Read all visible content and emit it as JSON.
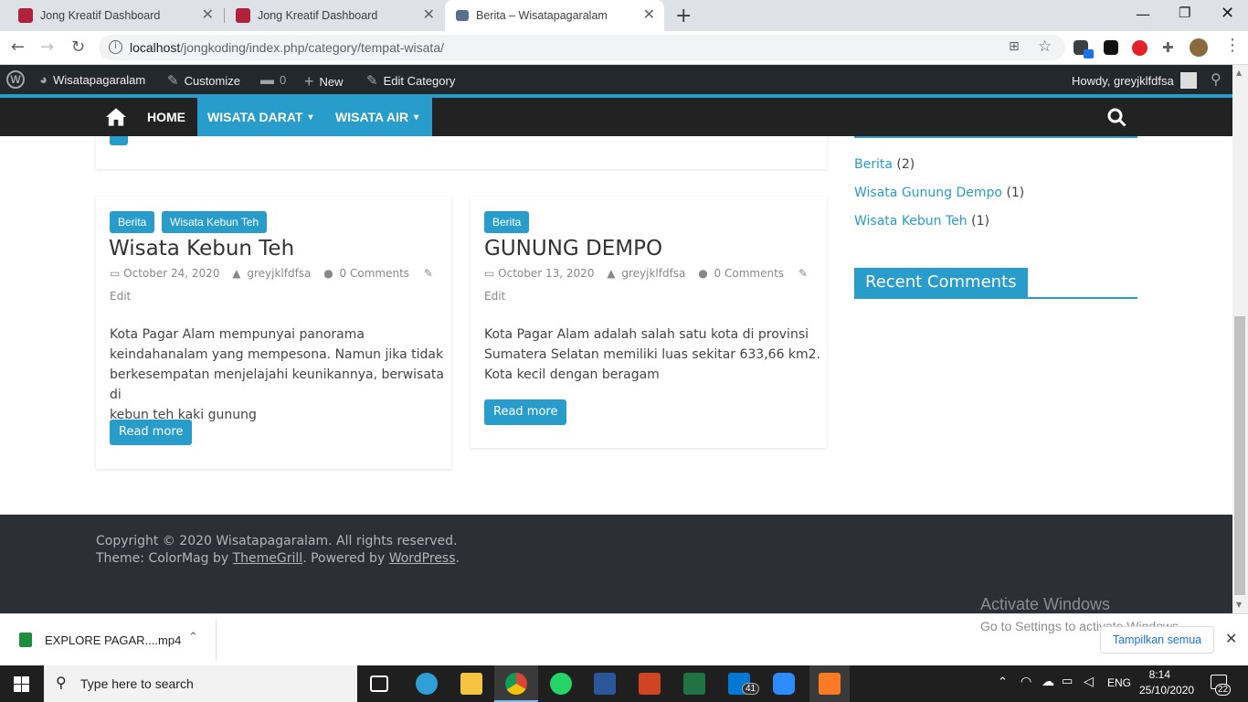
{
  "browser": {
    "tabs": [
      {
        "title": "Jong Kreatif Dashboard",
        "active": false
      },
      {
        "title": "Jong Kreatif Dashboard",
        "active": false
      },
      {
        "title": "Berita – Wisatapagaralam",
        "active": true
      }
    ],
    "url_host": "localhost",
    "url_path": "/jongkoding/index.php/category/tempat-wisata/"
  },
  "adminbar": {
    "site_name": "Wisatapagaralam",
    "customize": "Customize",
    "comments_count": "0",
    "new": "New",
    "edit_category": "Edit Category",
    "howdy": "Howdy, greyjklfdfsa"
  },
  "nav": {
    "items": [
      "HOME",
      "WISATA DARAT",
      "WISATA AIR"
    ]
  },
  "posts": [
    {
      "categories": [
        "Berita",
        "Wisata Kebun Teh"
      ],
      "title": "Wisata Kebun Teh",
      "date": "October 24, 2020",
      "author": "greyjklfdfsa",
      "comments": "0 Comments",
      "edit": "Edit",
      "excerpt_lines": [
        "Kota Pagar Alam mempunyai panorama",
        "keindahanalam yang mempesona. Namun jika tidak",
        "berkesempatan menjelajahi keunikannya, berwisata di",
        "kebun teh kaki gunung"
      ],
      "read_more": "Read more"
    },
    {
      "categories": [
        "Berita"
      ],
      "title": "GUNUNG DEMPO",
      "date": "October 13, 2020",
      "author": "greyjklfdfsa",
      "comments": "0 Comments",
      "edit": "Edit",
      "excerpt_lines": [
        "Kota Pagar Alam adalah salah satu kota di provinsi",
        "Sumatera Selatan memiliki luas sekitar 633,66 km2.",
        "Kota kecil dengan beragam"
      ],
      "read_more": "Read more"
    }
  ],
  "sidebar": {
    "categories": [
      {
        "name": "Berita",
        "count": "(2)"
      },
      {
        "name": "Wisata Gunung Dempo",
        "count": "(1)"
      },
      {
        "name": "Wisata Kebun Teh",
        "count": "(1)"
      }
    ],
    "recent_comments_title": "Recent Comments"
  },
  "footer": {
    "copyright_prefix": "Copyright © 2020 ",
    "site_link": "Wisatapagaralam",
    "copyright_suffix": ". All rights reserved.",
    "theme_prefix": "Theme: ColorMag by ",
    "themegrill": "ThemeGrill",
    "powered": ". Powered by ",
    "wordpress": "WordPress",
    "end": "."
  },
  "watermark": {
    "line1": "Activate Windows",
    "line2": "Go to Settings to activate Windows."
  },
  "download": {
    "filename": "EXPLORE PAGAR....mp4",
    "show_all": "Tampilkan semua"
  },
  "taskbar": {
    "search_placeholder": "Type here to search",
    "lang": "ENG",
    "time": "8:14",
    "date": "25/10/2020",
    "mail_badge": "41",
    "notif_badge": "22"
  },
  "colors": {
    "accent": "#289dcc",
    "adminbar": "#23282d",
    "footer": "#2c3036"
  }
}
